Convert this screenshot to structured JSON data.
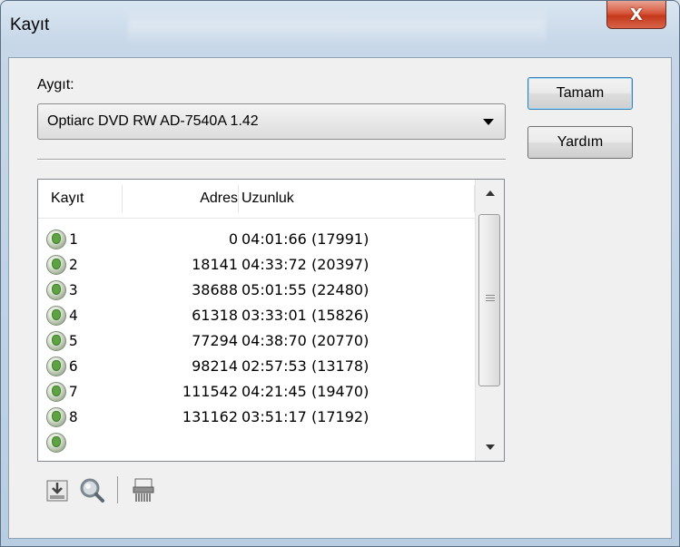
{
  "window": {
    "title": "Kayıt",
    "close_label": "X"
  },
  "device": {
    "label": "Aygıt:",
    "selected": "Optiarc DVD RW AD-7540A 1.42"
  },
  "buttons": {
    "ok": "Tamam",
    "help": "Yardım"
  },
  "tracks": {
    "headers": [
      "Kayıt",
      "Adres",
      "Uzunluk"
    ],
    "rows": [
      {
        "track": "1",
        "address": "0",
        "length": "04:01:66 (17991)"
      },
      {
        "track": "2",
        "address": "18141",
        "length": "04:33:72 (20397)"
      },
      {
        "track": "3",
        "address": "38688",
        "length": "05:01:55 (22480)"
      },
      {
        "track": "4",
        "address": "61318",
        "length": "03:33:01 (15826)"
      },
      {
        "track": "5",
        "address": "77294",
        "length": "04:38:70 (20770)"
      },
      {
        "track": "6",
        "address": "98214",
        "length": "02:57:53 (13178)"
      },
      {
        "track": "7",
        "address": "111542",
        "length": "04:21:45 (19470)"
      },
      {
        "track": "8",
        "address": "131162",
        "length": "03:51:17 (17192)"
      }
    ]
  },
  "toolbar": {
    "icons": [
      "save-icon",
      "magnifier-icon",
      "shredder-icon"
    ]
  },
  "colors": {
    "close_button": "#d8573c",
    "default_button_border": "#3c7fb1",
    "track_icon": "#5ea341"
  }
}
